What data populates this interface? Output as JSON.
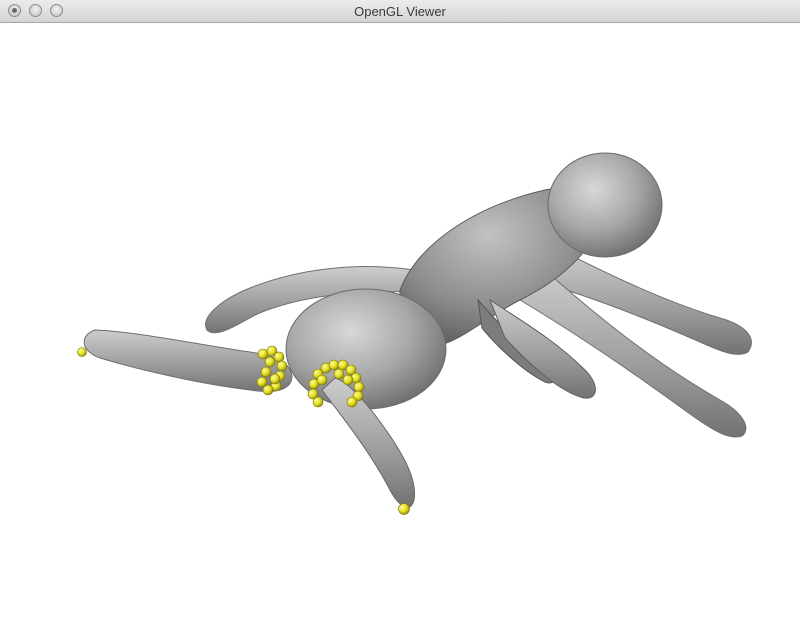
{
  "window": {
    "title": "OpenGL Viewer",
    "buttons": [
      "close",
      "minimize",
      "zoom"
    ]
  },
  "scene": {
    "background": "#ffffff",
    "mesh_color": "#a9a9a9",
    "marker_color": "#e8e020"
  }
}
